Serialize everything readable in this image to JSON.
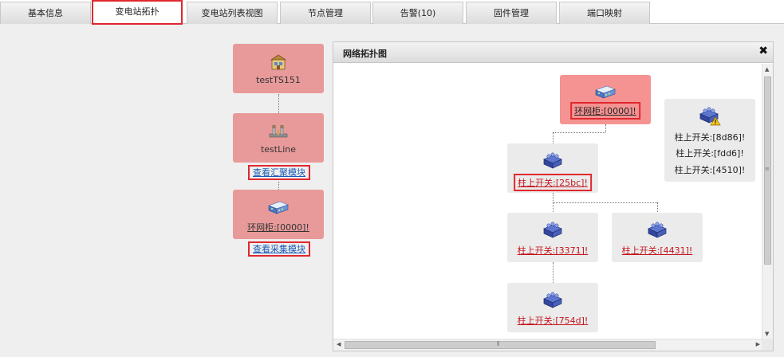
{
  "tabs": [
    {
      "label": "基本信息",
      "active": false
    },
    {
      "label": "变电站拓扑",
      "active": true
    },
    {
      "label": "变电站列表视图",
      "active": false
    },
    {
      "label": "节点管理",
      "active": false
    },
    {
      "label": "告警(10)",
      "active": false
    },
    {
      "label": "固件管理",
      "active": false
    },
    {
      "label": "端口映射",
      "active": false
    }
  ],
  "left_tree": {
    "station_label": "testTS151",
    "line_label": "testLine",
    "view_aggregation_label": "查看汇聚模块",
    "cabinet_label": "环网柜:[0000]!",
    "view_collection_label": "查看采集模块"
  },
  "panel": {
    "title": "网络拓扑图",
    "close_symbol": "✖",
    "root_label": "环网柜:[0000]!",
    "switch_25bc": "柱上开关:[25bc]!",
    "switch_3371": "柱上开关:[3371]!",
    "switch_4431": "柱上开关:[4431]!",
    "switch_754d": "柱上开关:[754d]!",
    "unlinked": [
      "柱上开关:[8d86]!",
      "柱上开关:[fdd6]!",
      "柱上开关:[4510]!"
    ]
  },
  "colors": {
    "accent_border": "#e0282e",
    "node_pink": "#e89a9a",
    "link_red": "#c3141c",
    "link_blue": "#1a5bb5"
  },
  "icons": {
    "station": "building-icon",
    "line": "power-line-icon",
    "cabinet": "ring-cabinet-icon",
    "switch": "pole-switch-icon",
    "warning": "warning-icon"
  }
}
